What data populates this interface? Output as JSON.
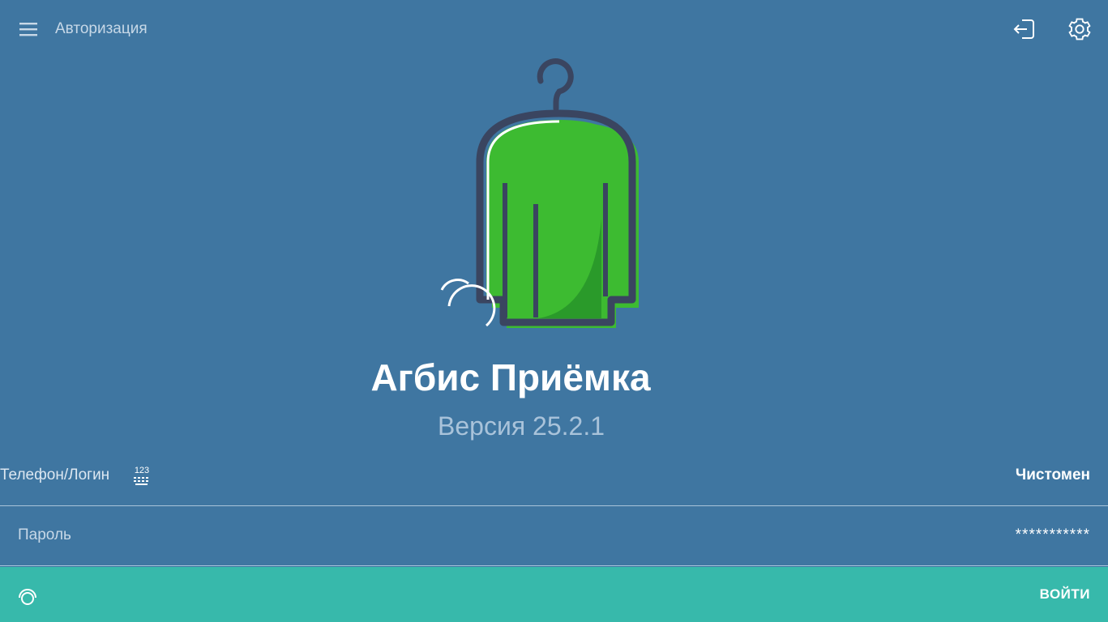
{
  "header": {
    "title": "Авторизация",
    "menu_icon": "hamburger-menu-icon",
    "logout_icon": "logout-door-icon",
    "settings_icon": "gear-icon"
  },
  "branding": {
    "app_name": "Агбис Приёмка",
    "version": "Версия 25.2.1",
    "logo_icon": "garment-hanger-logo",
    "colors": {
      "background": "#3f76a1",
      "logo_green": "#3dbb31",
      "logo_outline": "#3a4560",
      "accent_teal": "#37b9ab"
    }
  },
  "form": {
    "login": {
      "label": "Телефон/Логин",
      "keyboard_icon": "numeric-keyboard-icon",
      "keyboard_icon_text": "123",
      "value": "Чистомен"
    },
    "password": {
      "label": "Пароль",
      "value": "***********"
    }
  },
  "actions": {
    "nfc_icon": "nfc-scan-icon",
    "login_label": "ВОЙТИ"
  }
}
